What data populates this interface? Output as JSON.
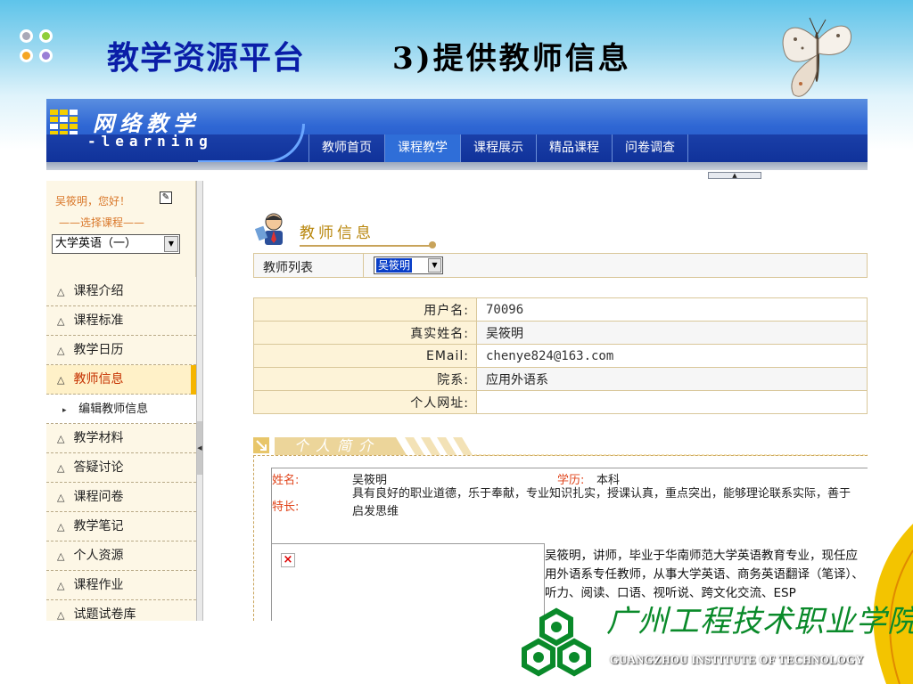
{
  "slide": {
    "title": "教学资源平台",
    "subtitle": "3)提供教师信息"
  },
  "app": {
    "logo_cn": "网络教学",
    "logo_en": "-learning",
    "tabs": [
      {
        "label": "教师首页"
      },
      {
        "label": "课程教学",
        "active": true
      },
      {
        "label": "课程展示"
      },
      {
        "label": "精品课程"
      },
      {
        "label": "问卷调查"
      }
    ]
  },
  "sidebar": {
    "greeting": "吴筱明，您好！",
    "choose_label": "——选择课程——",
    "course_selected": "大学英语（一）",
    "items": [
      {
        "label": "课程介绍"
      },
      {
        "label": "课程标准"
      },
      {
        "label": "教学日历"
      },
      {
        "label": "教师信息",
        "active": true
      },
      {
        "label": "编辑教师信息",
        "sub": true
      },
      {
        "label": "教学材料"
      },
      {
        "label": "答疑讨论"
      },
      {
        "label": "课程问卷"
      },
      {
        "label": "教学笔记"
      },
      {
        "label": "个人资源"
      },
      {
        "label": "课程作业"
      },
      {
        "label": "试题试卷库"
      }
    ]
  },
  "main": {
    "section_title": "教师信息",
    "list_label": "教师列表",
    "teacher_selected": "吴筱明",
    "info": {
      "username_label": "用户名:",
      "username": "70096",
      "realname_label": "真实姓名:",
      "realname": "吴筱明",
      "email_label": "EMail:",
      "email": "chenye824@163.com",
      "dept_label": "院系:",
      "dept": "应用外语系",
      "homepage_label": "个人网址:",
      "homepage": ""
    },
    "profile": {
      "banner": "个人简介",
      "name_label": "姓名:",
      "name": "吴筱明",
      "edu_label": "学历:",
      "edu": "本科",
      "specialty_label": "特长:",
      "specialty": "具有良好的职业道德，乐于奉献，专业知识扎实，授课认真，重点突出，能够理论联系实际，善于启发思维",
      "bio": "吴筱明，讲师，毕业于华南师范大学英语教育专业，现任应用外语系专任教师，从事大学英语、商务英语翻译（笔译）、听力、阅读、口语、视听说、跨文化交流、ESP"
    }
  },
  "school": {
    "name_cn": "广州工程技术职业学院",
    "name_en": "GUANGZHOU INSTITUTE OF TECHNOLOGY"
  },
  "colors": {
    "title_blue": "#0a1ea8",
    "nav_blue": "#10329a",
    "active_menu": "#c53100",
    "label_red": "#e0441b",
    "school_green": "#0a8a2a"
  }
}
